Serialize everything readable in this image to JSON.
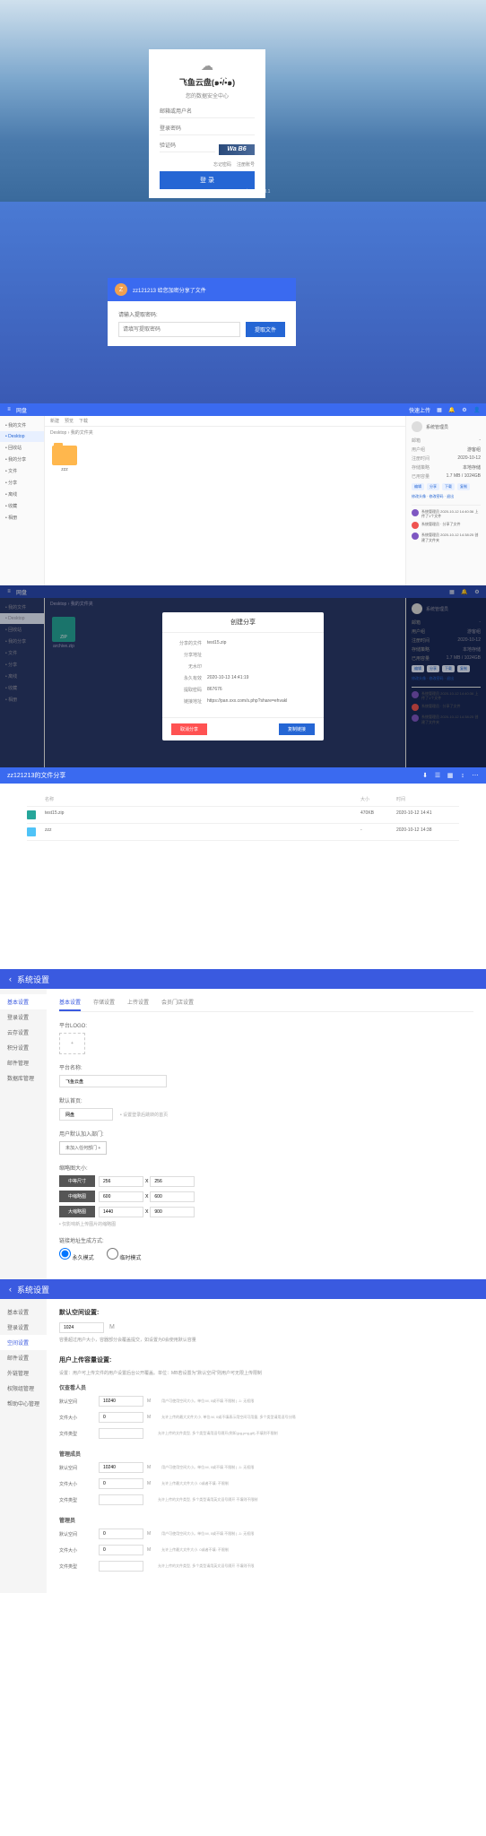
{
  "login": {
    "title": "飞鱼云盘(๑•́/•̀๑)",
    "subtitle": "您的数据安全中心",
    "user_ph": "邮箱或用户名",
    "pwd_ph": "登录密码",
    "captcha_ph": "验证码",
    "captcha_img": "Wa B6",
    "forgot": "忘记密码",
    "register": "注册账号",
    "submit": "登 录",
    "powered": "Powered By 飞鱼云盘 1.3.1"
  },
  "extract": {
    "avatar": "Z",
    "head": "zz121213  给您加密分享了文件",
    "label": "请输入提取密码:",
    "ph": "请填写提取密码",
    "btn": "提取文件"
  },
  "fm": {
    "brand": "网盘",
    "upload": "快速上传",
    "sidebar": [
      "我的文件",
      "Desktop",
      "回收站",
      "我的分享",
      "文件",
      "分享",
      "离线",
      "收藏",
      "相册"
    ],
    "toolbar": [
      "新建",
      "预览",
      "下载"
    ],
    "crumb": "Desktop › 我的文件夹",
    "folder_name": "zzz",
    "zip_label": "ZIP",
    "zip_name": "archive.zip",
    "right": {
      "user": "系统管理员",
      "rows": [
        [
          "邮箱",
          "-"
        ],
        [
          "用户组",
          "游客组"
        ],
        [
          "注册时间",
          "2020-10-12"
        ],
        [
          "存储策略",
          "本地存储"
        ],
        [
          "已用容量",
          "1.7 MB / 1024GB"
        ]
      ],
      "tags": [
        "编辑",
        "分享",
        "下载",
        "复制"
      ],
      "actions": "修改头像 · 修改密码 · 退出",
      "comments": [
        {
          "c": "#7e57c2",
          "t": "系统管理员 2020-10-12 14:40:36 上传了1个文件"
        },
        {
          "c": "#ef5350",
          "t": "系统管理员 · 分享了文件"
        },
        {
          "c": "#7e57c2",
          "t": "系统管理员 2020-10-12 14:38:25 创建了文件夹"
        }
      ]
    }
  },
  "modal": {
    "title": "创建分享",
    "rows": [
      [
        "分享的文件",
        "test15.zip"
      ],
      [
        "分享地址",
        ""
      ],
      [
        "无水印",
        ""
      ],
      [
        "永久有效",
        "2020-10-13 14:41:19"
      ],
      [
        "提取密码",
        "867676"
      ],
      [
        "链接地址",
        "https://pan.xxx.com/s.php?share=ehvakl"
      ]
    ],
    "cancel": "取消分享",
    "copy": "复制链接"
  },
  "sharelist": {
    "title": "zz121213的文件分享",
    "rows": [
      {
        "ic": "g",
        "name": "test15.zip",
        "size": "470KB",
        "time": "2020-10-12 14:41"
      },
      {
        "ic": "b",
        "name": "zzz",
        "size": "-",
        "time": "2020-10-12 14:38"
      }
    ],
    "head": [
      "名称",
      "大小",
      "时间"
    ]
  },
  "set": {
    "title": "系统设置",
    "side": [
      "基本设置",
      "登录设置",
      "云存设置",
      "积分设置",
      "邮件管理",
      "数据库管理"
    ],
    "side2": [
      "基本设置",
      "登录设置",
      "空间设置",
      "邮件设置",
      "外链管理",
      "权限组管理",
      "帮助中心管理"
    ],
    "tabs": [
      "基本设置",
      "存储设置",
      "上传设置",
      "会员门店设置"
    ],
    "logo_label": "平台LOGO:",
    "logo_btn": "+",
    "name_label": "平台名称:",
    "name_val": "飞鱼云盘",
    "nav_label": "默认首页:",
    "nav_val": "网盘",
    "nav_hint": "• 设置登录后跳转的首页",
    "reg_label": "用户默认加入部门:",
    "reg_btn": "未加入任何部门 +",
    "thumb_label": "缩略图大小:",
    "thumb_s": "中等尺寸",
    "thumb_sv": [
      "256",
      "x",
      "256"
    ],
    "thumb_m": "中缩略图",
    "thumb_mv": [
      "600",
      "x",
      "600"
    ],
    "thumb_l": "大缩略图",
    "thumb_lv": [
      "1440",
      "x",
      "900"
    ],
    "thumb_hint": "• 仅影响新上传图片的缩略图",
    "url_label": "链接地址生成方式:",
    "url_r1": "永久模式",
    "url_r2": "临时模式"
  },
  "set2": {
    "sp_title": "默认空间设置:",
    "sp_val": "1024",
    "sp_unit": "M",
    "sp_hint": "容量超过用户大小，容器部分会覆盖提交，如设置为0会使用默认容量",
    "up_title": "用户上传容量设置:",
    "up_desc": "设置：用户可上传文件的用户设置后台公开覆盖。单位：MB若设置为\"默认空间\"则用户可无限上传限制",
    "groups": [
      {
        "name": "仅查看人员",
        "rows": [
          [
            "默认空间",
            "10240",
            "M",
            "用户可使用空间大小。单位:M, 0或不填 不限制 | -1: 无权限"
          ],
          [
            "文件大小",
            "0",
            "M",
            "允许上传的最大文件大小, 单位:M, 0或不填表示用空间可用量, 多个类型请用逗号分隔"
          ],
          [
            "文件类型",
            "",
            "",
            "允许上传的文件类型, 多个类型请用逗号隔开(例如:jpg,png,gif),不填则不限制"
          ]
        ]
      },
      {
        "name": "管理成员",
        "rows": [
          [
            "默认空间",
            "10240",
            "M",
            "用户可使用空间大小。单位:M, 0或不填 不限制 | -1: 无权限"
          ],
          [
            "文件大小",
            "0",
            "M",
            "允许上传最大文件大小. 0或者不填: 不限制"
          ],
          [
            "文件类型",
            "",
            "",
            "允许上传的文件类型, 多个类型请用英文逗号隔开 不填则不限制"
          ]
        ]
      },
      {
        "name": "管理员",
        "rows": [
          [
            "默认空间",
            "0",
            "M",
            "用户可使用空间大小。单位:M, 0或不填 不限制 | -1: 无权限"
          ],
          [
            "文件大小",
            "0",
            "M",
            "允许上传最大文件大小. 0或者不填: 不限制"
          ],
          [
            "文件类型",
            "",
            "",
            "允许上传的文件类型, 多个类型请用英文逗号隔开 不填则不限"
          ]
        ]
      }
    ]
  }
}
